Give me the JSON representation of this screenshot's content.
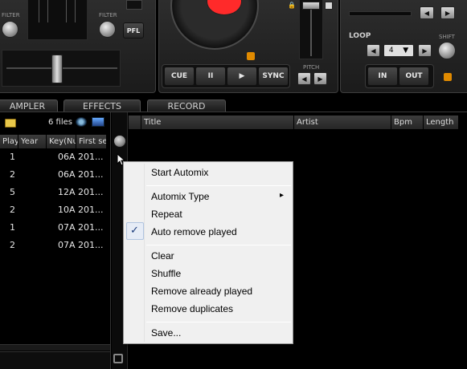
{
  "mixer": {
    "filter_left_label": "FILTER",
    "filter_right_label": "FILTER",
    "pfl_label": "PFL"
  },
  "deck": {
    "cue_label": "CUE",
    "pause_label": "II",
    "play_label": "▶",
    "sync_label": "SYNC",
    "pitch_label": "PITCH",
    "loop_label": "LOOP",
    "shift_label": "SHIFT",
    "loop_value": "4",
    "in_label": "IN",
    "out_label": "OUT",
    "accent_color": "#ff2a2a",
    "lock_color": "#e08a00"
  },
  "tabs": [
    "AMPLER",
    "EFFECTS",
    "RECORD"
  ],
  "browser": {
    "file_count": "6 files",
    "columns": [
      "Play",
      "Year",
      "Key(Nu",
      "First se"
    ],
    "rows": [
      {
        "play": "1",
        "key": "06A",
        "first": "201..."
      },
      {
        "play": "2",
        "key": "06A",
        "first": "201..."
      },
      {
        "play": "5",
        "key": "12A",
        "first": "201..."
      },
      {
        "play": "2",
        "key": "10A",
        "first": "201..."
      },
      {
        "play": "1",
        "key": "07A",
        "first": "201..."
      },
      {
        "play": "2",
        "key": "07A",
        "first": "201..."
      }
    ]
  },
  "automix": {
    "columns": [
      "Title",
      "Artist",
      "Bpm",
      "Length"
    ]
  },
  "context_menu": {
    "start_automix": "Start Automix",
    "automix_type": "Automix Type",
    "repeat": "Repeat",
    "auto_remove_played": "Auto remove played",
    "checkmark": "✓",
    "submenu_arrow": "▸",
    "clear": "Clear",
    "shuffle": "Shuffle",
    "remove_already_played": "Remove already played",
    "remove_duplicates": "Remove duplicates",
    "save": "Save..."
  }
}
